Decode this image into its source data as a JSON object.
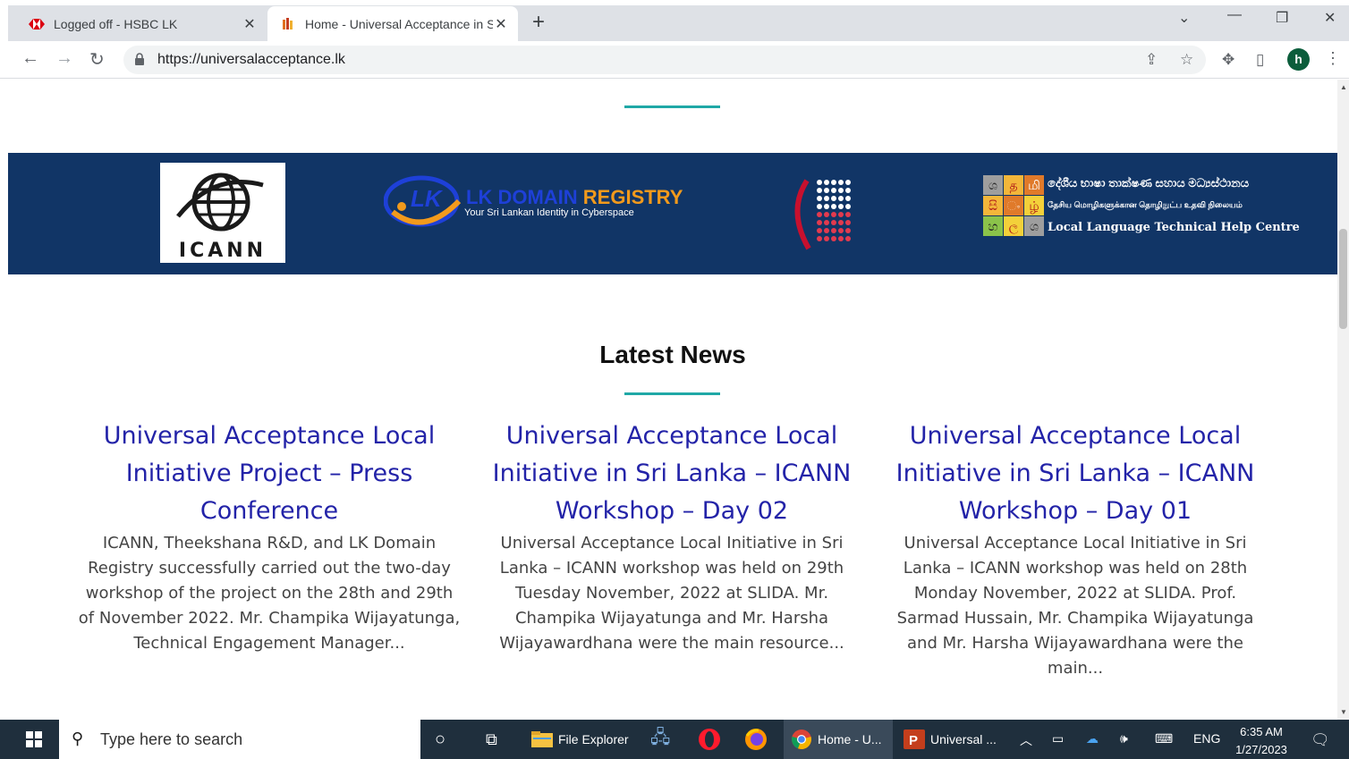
{
  "browser": {
    "tabs": [
      {
        "title": "Logged off - HSBC LK",
        "active": false
      },
      {
        "title": "Home - Universal Acceptance in S",
        "active": true
      }
    ],
    "url": "https://universalacceptance.lk",
    "profile_initial": "h"
  },
  "partners": {
    "icann": "ICANN",
    "lk_domain": {
      "name_part1": "LK DOMAIN",
      "name_part2": "REGISTRY",
      "tagline": "Your Sri Lankan Identity in Cyberspace",
      "badge": "LK"
    },
    "lltc": {
      "grid": [
        "ශ",
        "த",
        "மி",
        "සි",
        "ං",
        "ழ்",
        "හ",
        "ල",
        "ශ"
      ],
      "line1": "දේශීය භාෂා තාක්ෂණ සහාය මධ්‍යස්ථානය",
      "line2": "தேசிய மொழிகளுக்கான தொழிநுட்ப உதவி நிலையம்",
      "line3": "Local Language Technical Help Centre"
    }
  },
  "news": {
    "heading": "Latest News",
    "items": [
      {
        "title": "Universal Acceptance Local Initiative Project – Press Conference",
        "excerpt": "ICANN, Theekshana R&D, and LK Domain Registry successfully carried out the two-day workshop of the project on the 28th and 29th of November 2022. Mr. Champika Wijayatunga, Technical Engagement Manager..."
      },
      {
        "title": "Universal Acceptance Local Initiative in Sri Lanka – ICANN Workshop – Day 02",
        "excerpt": "Universal Acceptance Local Initiative in Sri Lanka – ICANN workshop was held on 29th Tuesday November, 2022 at SLIDA. Mr. Champika Wijayatunga  and Mr. Harsha Wijayawardhana were the main resource..."
      },
      {
        "title": "Universal Acceptance Local Initiative in Sri Lanka – ICANN Workshop – Day 01",
        "excerpt": "Universal Acceptance Local Initiative in Sri Lanka – ICANN workshop was held on 28th Monday November, 2022 at SLIDA. Prof. Sarmad Hussain, Mr. Champika Wijayatunga  and Mr. Harsha Wijayawardhana were the main..."
      }
    ]
  },
  "taskbar": {
    "search_placeholder": "Type here to search",
    "apps": [
      {
        "label": "File Explorer",
        "icon": "folder-icon"
      },
      {
        "label": "Home - U...",
        "icon": "chrome-icon"
      },
      {
        "label": "Universal ...",
        "icon": "powerpoint-icon"
      }
    ],
    "language": "ENG",
    "time": "6:35 AM",
    "date": "1/27/2023"
  },
  "colors": {
    "partner_band": "#113566",
    "accent_teal": "#1fa8a6",
    "news_title": "#2323a8"
  }
}
